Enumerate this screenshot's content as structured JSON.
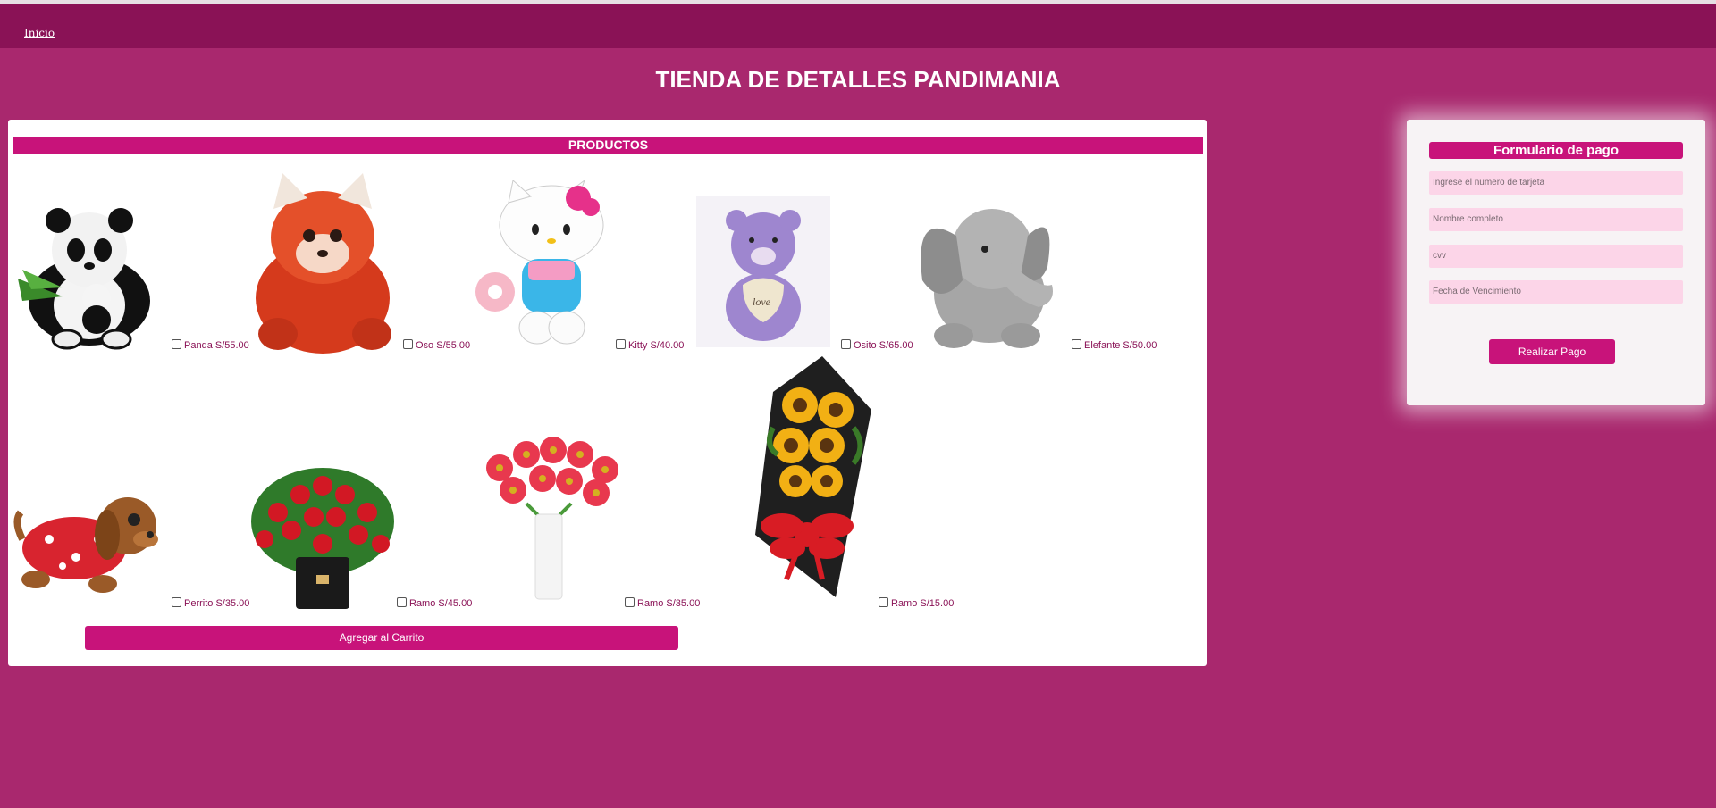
{
  "nav": {
    "home_label": "Inicio"
  },
  "page": {
    "title": "TIENDA DE DETALLES PANDIMANIA"
  },
  "products": {
    "header": "PRODUCTOS",
    "items": [
      {
        "label": "Panda S/55.00",
        "icon": "panda-plush-icon"
      },
      {
        "label": "Oso S/55.00",
        "icon": "red-panda-plush-icon"
      },
      {
        "label": "Kitty S/40.00",
        "icon": "hello-kitty-plush-icon"
      },
      {
        "label": "Osito S/65.00",
        "icon": "purple-teddy-bear-icon"
      },
      {
        "label": "Elefante S/50.00",
        "icon": "elephant-plush-icon"
      },
      {
        "label": "Perrito S/35.00",
        "icon": "puppy-plush-icon"
      },
      {
        "label": "Ramo S/45.00",
        "icon": "rose-box-bouquet-icon"
      },
      {
        "label": "Ramo S/35.00",
        "icon": "gerbera-vase-bouquet-icon"
      },
      {
        "label": "Ramo S/15.00",
        "icon": "sunflower-bouquet-icon"
      }
    ],
    "add_to_cart_label": "Agregar al Carrito"
  },
  "payment_form": {
    "title": "Formulario de pago",
    "card_number_placeholder": "Ingrese el numero de tarjeta",
    "full_name_placeholder": "Nombre completo",
    "cvv_placeholder": "cvv",
    "expiry_placeholder": "Fecha de Vencimiento",
    "submit_label": "Realizar Pago"
  },
  "colors": {
    "background": "#a9286e",
    "navbar": "#8a1256",
    "accent": "#c8137a",
    "input_bg": "#fcd5e8"
  }
}
